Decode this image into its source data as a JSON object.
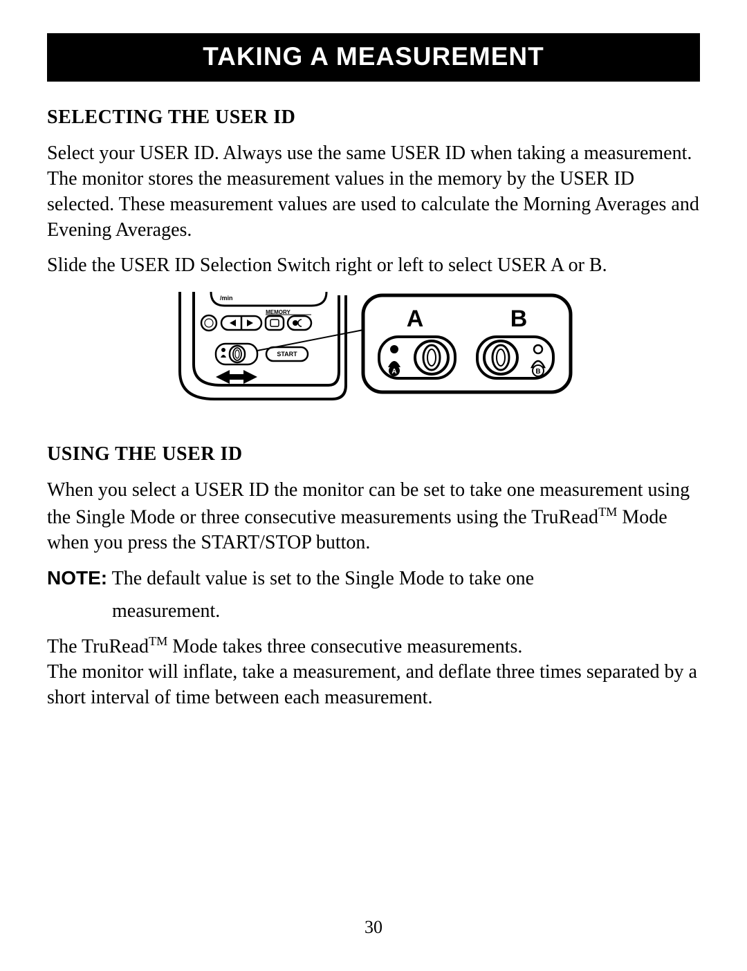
{
  "title": "TAKING A MEASUREMENT",
  "section1": {
    "heading": "SELECTING THE USER ID",
    "para1": "Select your USER ID. Always use the same USER ID when taking a measurement. The monitor stores the measurement values in the memory by the USER ID selected. These measurement values are used to calculate the Morning Averages and Evening Averages.",
    "para2": "Slide the USER ID Selection Switch right or left to select USER A or B."
  },
  "diagram": {
    "memory_label": "MEMORY",
    "start_label": "START",
    "min_label": "/min",
    "callout_A": "A",
    "callout_B": "B",
    "switch_A": "A",
    "switch_B": "B"
  },
  "section2": {
    "heading": "USING THE USER ID",
    "para1_pre": "When you select a USER ID the monitor can be set to take one measurement using the Single Mode or three consecutive measurements using the TruRead",
    "para1_post": " Mode when you press the START/STOP button.",
    "note_label": "NOTE:",
    "note_text1": " The default value is set to the Single Mode to take one",
    "note_text2": "measurement.",
    "para2_pre": "The TruRead",
    "para2_post": " Mode takes three consecutive measurements.",
    "para3": "The monitor will inflate, take a measurement, and deflate three times separated by a short interval of time between each measurement."
  },
  "tm": "TM",
  "page_number": "30"
}
